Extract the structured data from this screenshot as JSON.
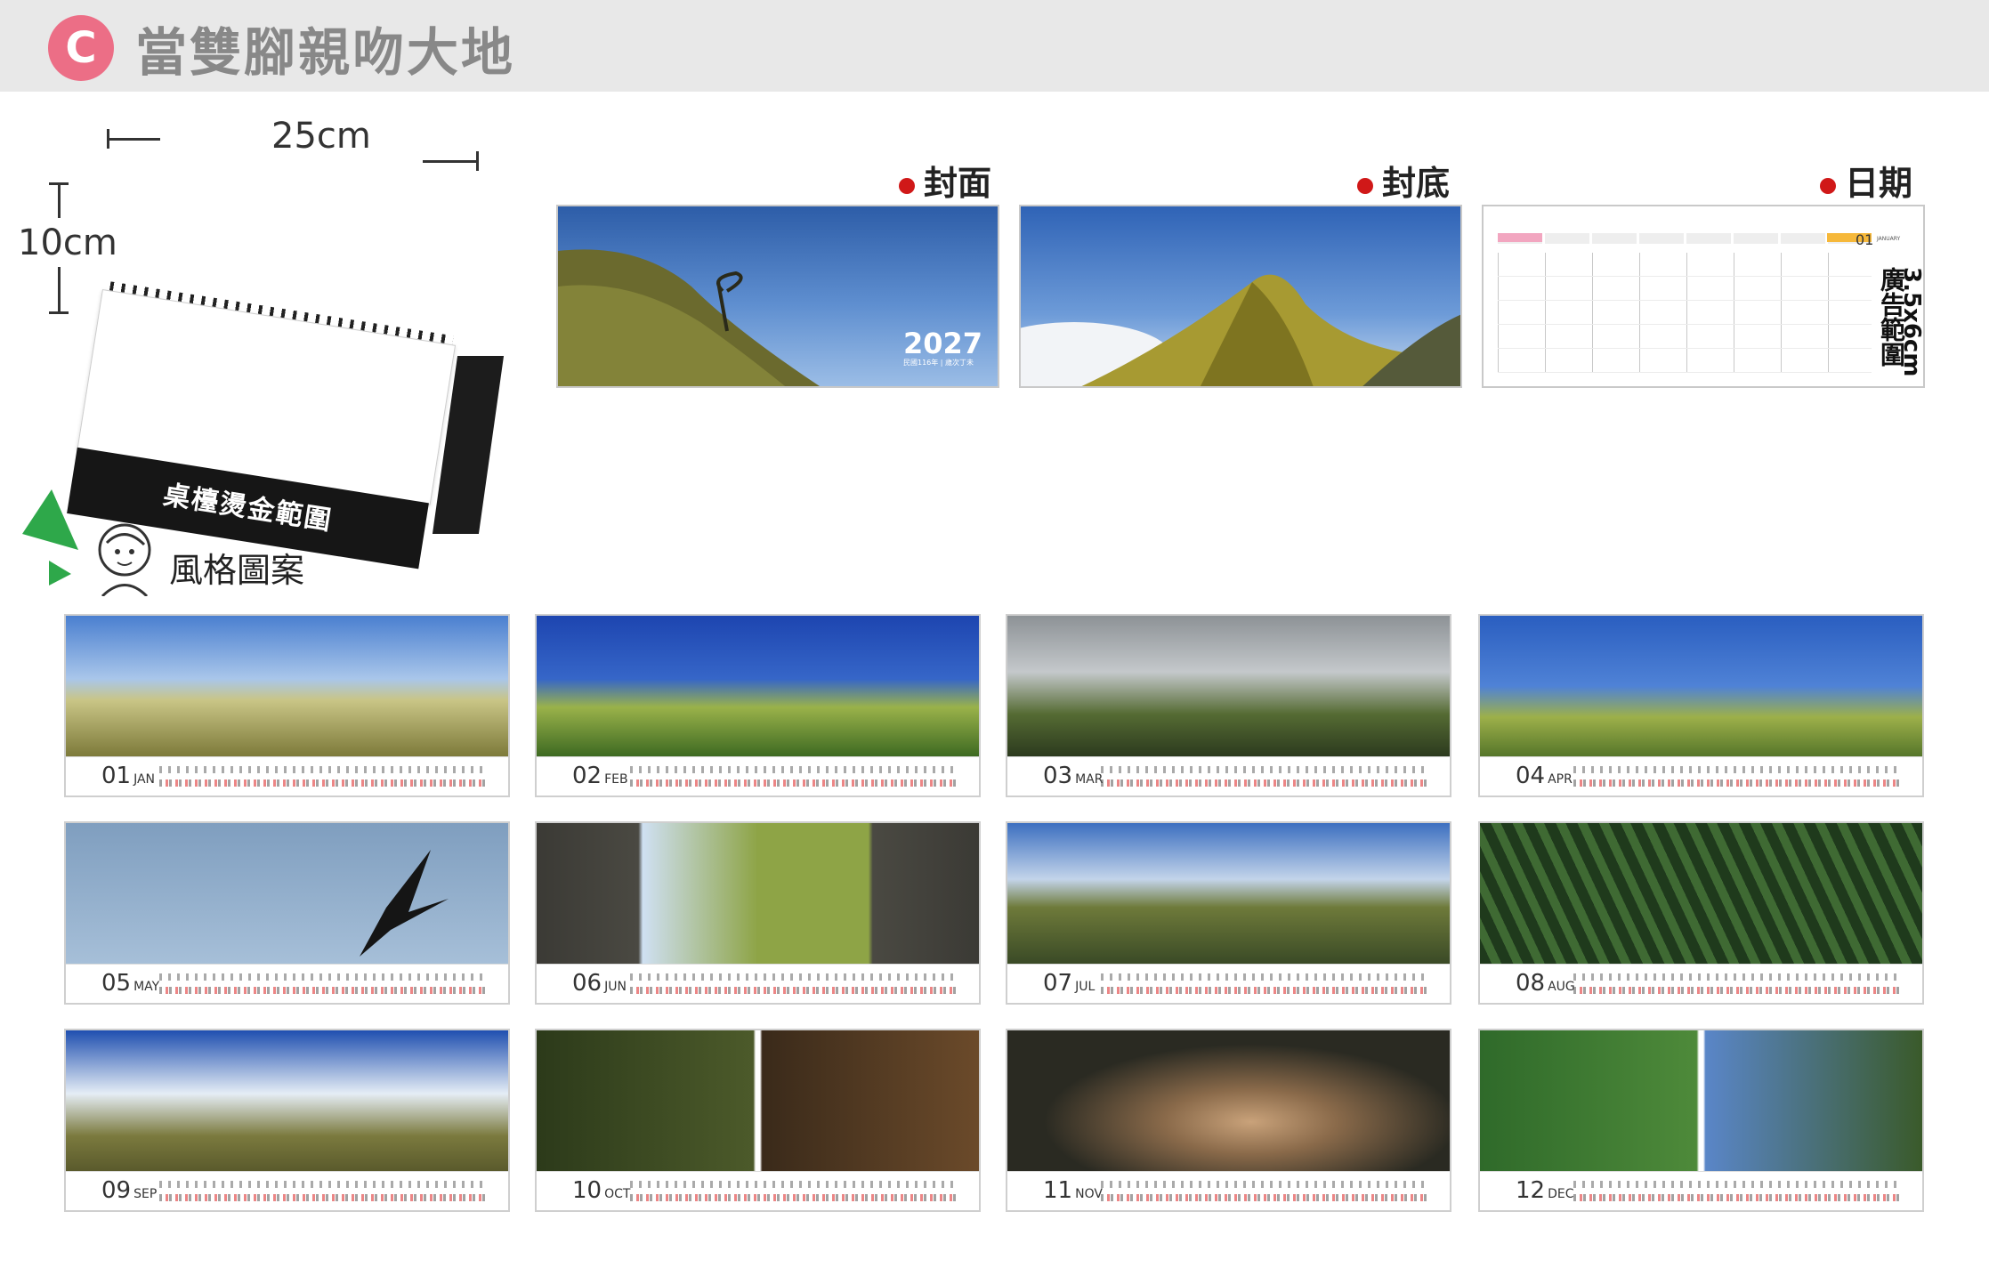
{
  "header": {
    "badge": "C",
    "title": "當雙腳親吻大地"
  },
  "mockup": {
    "width_label": "25cm",
    "height_label": "10cm",
    "stamp_label": "桌檯燙金範圍"
  },
  "previews": {
    "cover": {
      "label": "封面",
      "year": "2027",
      "sub": "民國116年 | 歲次丁未"
    },
    "back": {
      "label": "封底"
    },
    "date": {
      "label": "日期",
      "month_num": "01",
      "month_name": "JANUARY",
      "ad_size": "3.5x6cm",
      "ad_label": "廣告範圍"
    }
  },
  "section": {
    "label": "風格圖案"
  },
  "months": [
    {
      "num": "01",
      "name": "JAN"
    },
    {
      "num": "02",
      "name": "FEB"
    },
    {
      "num": "03",
      "name": "MAR"
    },
    {
      "num": "04",
      "name": "APR"
    },
    {
      "num": "05",
      "name": "MAY"
    },
    {
      "num": "06",
      "name": "JUN"
    },
    {
      "num": "07",
      "name": "JUL"
    },
    {
      "num": "08",
      "name": "AUG"
    },
    {
      "num": "09",
      "name": "SEP"
    },
    {
      "num": "10",
      "name": "OCT"
    },
    {
      "num": "11",
      "name": "NOV"
    },
    {
      "num": "12",
      "name": "DEC"
    }
  ]
}
